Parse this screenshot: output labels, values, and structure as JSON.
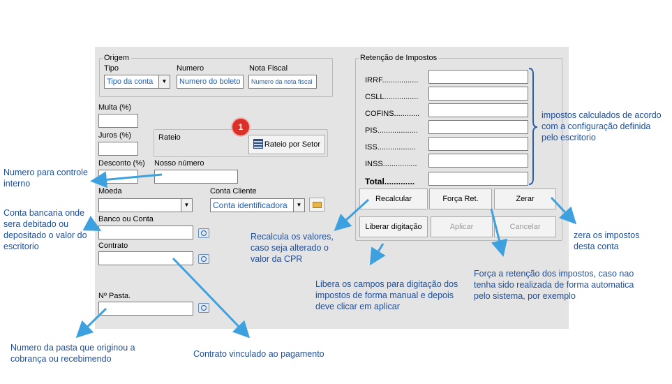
{
  "origem": {
    "legend": "Origem",
    "tipo_label": "Tipo",
    "tipo_value": "Tipo da conta",
    "numero_label": "Numero",
    "numero_value": "Numero do boleto",
    "nota_label": "Nota Fiscal",
    "nota_value": "Numero da nota fiscal"
  },
  "fields": {
    "multa": "Multa (%)",
    "juros": "Juros (%)",
    "desconto": "Desconto (%)",
    "nosso_numero": "Nosso número",
    "moeda": "Moeda",
    "conta_cliente": "Conta Cliente",
    "conta_cliente_value": "Conta identificadora",
    "banco": "Banco ou Conta",
    "contrato": "Contrato",
    "pasta": "Nº Pasta."
  },
  "rateio": {
    "label": "Rateio",
    "button": "Rateio por Setor",
    "badge": "1"
  },
  "retencao": {
    "legend": "Retenção de Impostos",
    "taxes": [
      "IRRF.................",
      "CSLL................",
      "COFINS............",
      "PIS...................",
      "ISS..................",
      "INSS................"
    ],
    "total": "Total.............",
    "buttons": {
      "recalcular": "Recalcular",
      "forca": "Força Ret.",
      "zerar": "Zerar",
      "liberar": "Liberar digitação",
      "aplicar": "Aplicar",
      "cancelar": "Cancelar"
    }
  },
  "annotations": {
    "impostos": "impostos calculados de acordo com a configuração definida pelo escritorio",
    "numero_controle": "Numero para controle interno",
    "conta_bancaria": "Conta bancaria onde sera debitado ou depositado o valor do escritorio",
    "recalcula": "Recalcula os valores, caso seja alterado o valor da CPR",
    "zera": "zera os impostos desta conta",
    "libera": "Libera os campos para digitação dos impostos de forma manual e depois deve clicar em aplicar",
    "forca": "Força a retenção dos impostos, caso nao tenha sido realizada de forma automatica pelo sistema, por exemplo",
    "pasta": "Numero da pasta que originou a cobrança ou recebimendo",
    "contrato": "Contrato vinculado ao pagamento"
  }
}
